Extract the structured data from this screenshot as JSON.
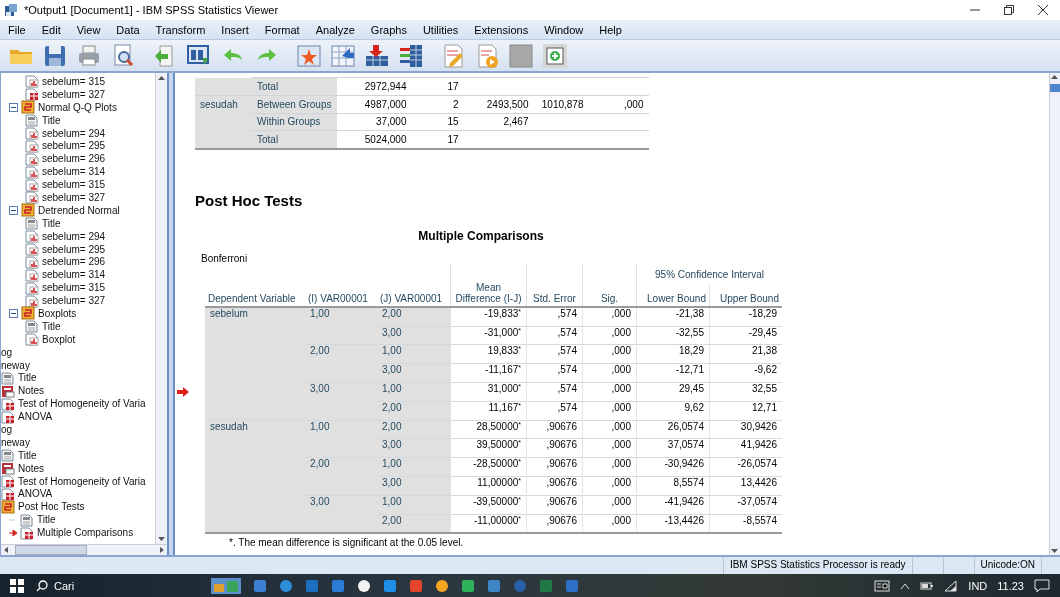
{
  "window": {
    "title": "*Output1 [Document1] - IBM SPSS Statistics Viewer"
  },
  "menu": [
    "File",
    "Edit",
    "View",
    "Data",
    "Transform",
    "Insert",
    "Format",
    "Analyze",
    "Graphs",
    "Utilities",
    "Extensions",
    "Window",
    "Help"
  ],
  "navigator": {
    "items": [
      {
        "kind": "group",
        "children": [
          {
            "kind": "group",
            "children": [
              {
                "kind": "group",
                "children": [
                  {
                    "kind": "chart",
                    "label": "sebelum= 315"
                  },
                  {
                    "kind": "table",
                    "label": "sebelum= 327"
                  }
                ]
              },
              {
                "kind": "heading",
                "label": "Normal Q-Q Plots",
                "expanded": true,
                "children": [
                  {
                    "kind": "title",
                    "label": "Title"
                  },
                  {
                    "kind": "chart",
                    "label": "sebelum= 294"
                  },
                  {
                    "kind": "chart",
                    "label": "sebelum= 295"
                  },
                  {
                    "kind": "chart",
                    "label": "sebelum= 296"
                  },
                  {
                    "kind": "chart",
                    "label": "sebelum= 314"
                  },
                  {
                    "kind": "chart",
                    "label": "sebelum= 315"
                  },
                  {
                    "kind": "chart",
                    "label": "sebelum= 327"
                  }
                ]
              },
              {
                "kind": "heading",
                "label": "Detrended Normal",
                "expanded": true,
                "children": [
                  {
                    "kind": "title",
                    "label": "Title"
                  },
                  {
                    "kind": "chart",
                    "label": "sebelum= 294"
                  },
                  {
                    "kind": "chart",
                    "label": "sebelum= 295"
                  },
                  {
                    "kind": "chart",
                    "label": "sebelum= 296"
                  },
                  {
                    "kind": "chart",
                    "label": "sebelum= 314"
                  },
                  {
                    "kind": "chart",
                    "label": "sebelum= 315"
                  },
                  {
                    "kind": "chart",
                    "label": "sebelum= 327"
                  }
                ]
              },
              {
                "kind": "heading",
                "label": "Boxplots",
                "expanded": true,
                "children": [
                  {
                    "kind": "title",
                    "label": "Title"
                  },
                  {
                    "kind": "chart",
                    "label": "Boxplot"
                  }
                ]
              }
            ]
          }
        ]
      },
      {
        "label": "og"
      },
      {
        "label": "neway",
        "children": [
          {
            "kind": "title",
            "label": "Title"
          },
          {
            "kind": "notes",
            "label": "Notes"
          },
          {
            "kind": "table",
            "label": "Test of Homogeneity of Varia"
          },
          {
            "kind": "table",
            "label": "ANOVA"
          }
        ]
      },
      {
        "label": "og"
      },
      {
        "label": "neway",
        "children": [
          {
            "kind": "title",
            "label": "Title"
          },
          {
            "kind": "notes",
            "label": "Notes"
          },
          {
            "kind": "table",
            "label": "Test of Homogeneity of Varia"
          },
          {
            "kind": "table",
            "label": "ANOVA"
          },
          {
            "kind": "heading",
            "label": "Post Hoc Tests",
            "children": [
              {
                "kind": "title",
                "label": "Title",
                "current": false
              },
              {
                "kind": "table",
                "label": "Multiple Comparisons",
                "current": true
              }
            ]
          }
        ]
      }
    ]
  },
  "anova_table": {
    "rows": [
      {
        "source": "Total",
        "column_3": "2972,944",
        "column_4": "17"
      },
      {
        "variable": "sesudah",
        "source": "Between Groups",
        "column_3": "4987,000",
        "column_4": "2",
        "column_5": "2493,500",
        "column_6": "1010,878",
        "column_7": ",000"
      },
      {
        "source": "Within Groups",
        "column_3": "37,000",
        "column_4": "15",
        "column_5": "2,467"
      },
      {
        "source": "Total",
        "column_3": "5024,000",
        "column_4": "17"
      }
    ]
  },
  "section_heading": "Post Hoc Tests",
  "multiple_comparisons": {
    "title": "Multiple Comparisons",
    "method": "Bonferroni",
    "columns": [
      "Dependent Variable",
      "(I) VAR00001",
      "(J) VAR00001",
      "Mean Difference (I-J)",
      "Std. Error",
      "Sig.",
      "Lower Bound",
      "Upper Bound"
    ],
    "group_header": "95% Confidence Interval",
    "rows": [
      {
        "dependent_variable": "sebelum",
        "i": "1,00",
        "j": "2,00",
        "mean_difference": "-19,833$^{*}$",
        "std_error": ",574",
        "sig": ",000",
        "lower_bound": "-21,38",
        "upper_bound": "-18,29",
        "marker": false
      },
      {
        "j": "3,00",
        "mean_difference": "-31,000$^{*}$",
        "std_error": ",574",
        "sig": ",000",
        "lower_bound": "-32,55",
        "upper_bound": "-29,45",
        "marker": false
      },
      {
        "i": "2,00",
        "j": "1,00",
        "mean_difference": "19,833$^{*}$",
        "std_error": ",574",
        "sig": ",000",
        "lower_bound": "18,29",
        "upper_bound": "21,38",
        "marker": false
      },
      {
        "j": "3,00",
        "mean_difference": "-11,167$^{*}$",
        "std_error": ",574",
        "sig": ",000",
        "lower_bound": "-12,71",
        "upper_bound": "-9,62",
        "marker": false
      },
      {
        "i": "3,00",
        "j": "1,00",
        "mean_difference": "31,000$^{*}$",
        "std_error": ",574",
        "sig": ",000",
        "lower_bound": "29,45",
        "upper_bound": "32,55",
        "marker": true
      },
      {
        "j": "2,00",
        "mean_difference": "11,167$^{*}$",
        "std_error": ",574",
        "sig": ",000",
        "lower_bound": "9,62",
        "upper_bound": "12,71",
        "marker": false
      },
      {
        "dependent_variable": "sesudah",
        "i": "1,00",
        "j": "2,00",
        "mean_difference": "28,50000$^{*}$",
        "std_error": ",90676",
        "sig": ",000",
        "lower_bound": "26,0574",
        "upper_bound": "30,9426",
        "marker": false
      },
      {
        "j": "3,00",
        "mean_difference": "39,50000$^{*}$",
        "std_error": ",90676",
        "sig": ",000",
        "lower_bound": "37,0574",
        "upper_bound": "41,9426",
        "marker": false
      },
      {
        "i": "2,00",
        "j": "1,00",
        "mean_difference": "-28,50000$^{*}$",
        "std_error": ",90676",
        "sig": ",000",
        "lower_bound": "-30,9426",
        "upper_bound": "-26,0574",
        "marker": false
      },
      {
        "j": "3,00",
        "mean_difference": "11,00000$^{*}$",
        "std_error": ",90676",
        "sig": ",000",
        "lower_bound": "8,5574",
        "upper_bound": "13,4426",
        "marker": false
      },
      {
        "i": "3,00",
        "j": "1,00",
        "mean_difference": "-39,50000$^{*}$",
        "std_error": ",90676",
        "sig": ",000",
        "lower_bound": "-41,9426",
        "upper_bound": "-37,0574",
        "marker": false
      },
      {
        "j": "2,00",
        "mean_difference": "-11,00000$^{*}$",
        "std_error": ",90676",
        "sig": ",000",
        "lower_bound": "-13,4426",
        "upper_bound": "-8,5574",
        "marker": false
      }
    ],
    "footnote": "*. The mean difference is significant at the 0.05 level."
  },
  "status_bar": [
    "IBM SPSS Statistics Processor is ready",
    "Unicode:ON"
  ],
  "taskbar": {
    "search_placeholder": "Cari",
    "language": "IND",
    "time": "11.23"
  }
}
